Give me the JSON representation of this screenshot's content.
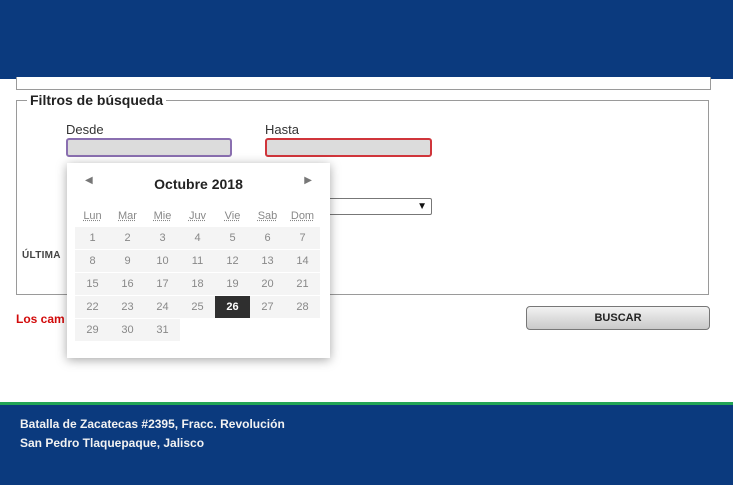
{
  "filters": {
    "legend": "Filtros de búsqueda",
    "desde_label": "Desde",
    "hasta_label": "Hasta",
    "ultima_label": "ÚLTIMA",
    "required_notice": "Los cam",
    "search_button": "BUSCAR"
  },
  "calendar": {
    "month_year": "Octubre 2018",
    "weekdays": [
      "Lun",
      "Mar",
      "Mie",
      "Juv",
      "Vie",
      "Sab",
      "Dom"
    ],
    "weeks": [
      [
        "1",
        "2",
        "3",
        "4",
        "5",
        "6",
        "7"
      ],
      [
        "8",
        "9",
        "10",
        "11",
        "12",
        "13",
        "14"
      ],
      [
        "15",
        "16",
        "17",
        "18",
        "19",
        "20",
        "21"
      ],
      [
        "22",
        "23",
        "24",
        "25",
        "26",
        "27",
        "28"
      ],
      [
        "29",
        "30",
        "31",
        "",
        "",
        "",
        ""
      ]
    ],
    "selected_day": "26"
  },
  "footer": {
    "address_line1": "Batalla de Zacatecas #2395, Fracc. Revolución",
    "address_line2": "San Pedro Tlaquepaque, Jalisco"
  },
  "colors": {
    "brand_blue": "#0b3a7e",
    "accent_green": "#23a455",
    "required_red": "#d20a0a",
    "selected_day_bg": "#2f2f2f"
  },
  "icons": {
    "prev": "triangle-left-icon",
    "next": "triangle-right-icon",
    "select_arrow": "triangle-down-icon"
  }
}
